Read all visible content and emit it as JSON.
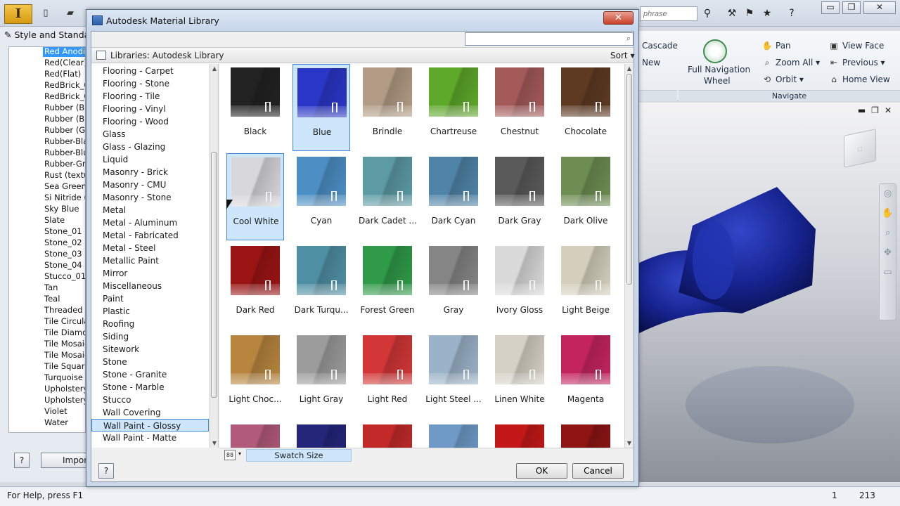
{
  "app": {
    "logo_letter": "I",
    "search_placeholder": "phrase",
    "help_icon": "?",
    "win_minimize": "▭",
    "win_restore": "❐",
    "win_close": "✕"
  },
  "ribbon": {
    "cascade": "Cascade",
    "new": "New",
    "full_nav_wheel_line1": "Full Navigation",
    "full_nav_wheel_line2": "Wheel",
    "pan": "Pan",
    "zoom_all": "Zoom All",
    "orbit": "Orbit",
    "view_face": "View Face",
    "previous": "Previous",
    "home_view": "Home View",
    "navigate_label": "Navigate"
  },
  "style_panel": {
    "title": "Style and Standa",
    "items": [
      "Red Anodiz",
      "Red(Clear)",
      "Red(Flat)",
      "RedBrick_01",
      "RedBrick_02",
      "Rubber (Bla",
      "Rubber (Blu",
      "Rubber (Gre",
      "Rubber-Blac",
      "Rubber-Blue",
      "Rubber-Gree",
      "Rust (textu",
      "Sea Green",
      "Si Nitride (P",
      "Sky Blue",
      "Slate",
      "Stone_01",
      "Stone_02",
      "Stone_03",
      "Stone_04",
      "Stucco_01",
      "Tan",
      "Teal",
      "Threaded",
      "Tile Circular",
      "Tile Diamon",
      "Tile Mosaic",
      "Tile Mosaic",
      "Tile Square",
      "Turquoise",
      "Upholstery",
      "Upholstery",
      "Violet",
      "Water"
    ],
    "selected_index": 0,
    "help_label": "?",
    "import_label": "Import"
  },
  "dialog": {
    "title": "Autodesk Material Library",
    "close_label": "✕",
    "search_value": "",
    "library_title": "Libraries: Autodesk Library",
    "sort_label": "Sort",
    "categories": [
      "Flooring - Carpet",
      "Flooring - Stone",
      "Flooring - Tile",
      "Flooring - Vinyl",
      "Flooring - Wood",
      "Glass",
      "Glass - Glazing",
      "Liquid",
      "Masonry - Brick",
      "Masonry - CMU",
      "Masonry - Stone",
      "Metal",
      "Metal - Aluminum",
      "Metal - Fabricated",
      "Metal - Steel",
      "Metallic Paint",
      "Mirror",
      "Miscellaneous",
      "Paint",
      "Plastic",
      "Roofing",
      "Siding",
      "Sitework",
      "Stone",
      "Stone - Granite",
      "Stone - Marble",
      "Stucco",
      "Wall Covering",
      "Wall Paint - Glossy",
      "Wall Paint - Matte"
    ],
    "selected_category": "Wall Paint - Glossy",
    "swatches": [
      {
        "name": "Black",
        "color": "#222222"
      },
      {
        "name": "Blue",
        "color": "#2a36c8",
        "selected": true
      },
      {
        "name": "Brindle",
        "color": "#b29b84"
      },
      {
        "name": "Chartreuse",
        "color": "#5ea82a"
      },
      {
        "name": "Chestnut",
        "color": "#a55a5a"
      },
      {
        "name": "Chocolate",
        "color": "#5e3a22"
      },
      {
        "name": "Cool White",
        "color": "#d7d7dc",
        "selected": true
      },
      {
        "name": "Cyan",
        "color": "#4c8fc4"
      },
      {
        "name": "Dark Cadet ...",
        "color": "#5c9aa4"
      },
      {
        "name": "Dark Cyan",
        "color": "#4f84a8"
      },
      {
        "name": "Dark Gray",
        "color": "#5a5a5a"
      },
      {
        "name": "Dark Olive",
        "color": "#6d8d52"
      },
      {
        "name": "Dark Red",
        "color": "#9a1414"
      },
      {
        "name": "Dark Turqu...",
        "color": "#4f8fa4"
      },
      {
        "name": "Forest Green",
        "color": "#2f9a48"
      },
      {
        "name": "Gray",
        "color": "#858585"
      },
      {
        "name": "Ivory Gloss",
        "color": "#dadada"
      },
      {
        "name": "Light Beige",
        "color": "#d4d0bd"
      },
      {
        "name": "Light Choc...",
        "color": "#b7853e"
      },
      {
        "name": "Light Gray",
        "color": "#9c9c9c"
      },
      {
        "name": "Light Red",
        "color": "#d23636"
      },
      {
        "name": "Light Steel ...",
        "color": "#9bb3c8"
      },
      {
        "name": "Linen White",
        "color": "#d6d1c6"
      },
      {
        "name": "Magenta",
        "color": "#c4245e"
      },
      {
        "name": "",
        "color": "#b25a7a"
      },
      {
        "name": "",
        "color": "#24267a"
      },
      {
        "name": "",
        "color": "#c22a2a"
      },
      {
        "name": "",
        "color": "#6f9ac8"
      },
      {
        "name": "",
        "color": "#c41818"
      },
      {
        "name": "",
        "color": "#8e1414"
      }
    ],
    "swatch_size_label": "Swatch Size",
    "view_toggle_label": "88",
    "help_label": "?",
    "ok_label": "OK",
    "cancel_label": "Cancel"
  },
  "status": {
    "help_text": "For Help, press F1",
    "value1": "1",
    "value2": "213"
  },
  "colors": {
    "selection_fill": "#cde6fb",
    "selection_border": "#3f89d8",
    "tree_selection": "#3399ff",
    "part_blue": "#16238f"
  }
}
